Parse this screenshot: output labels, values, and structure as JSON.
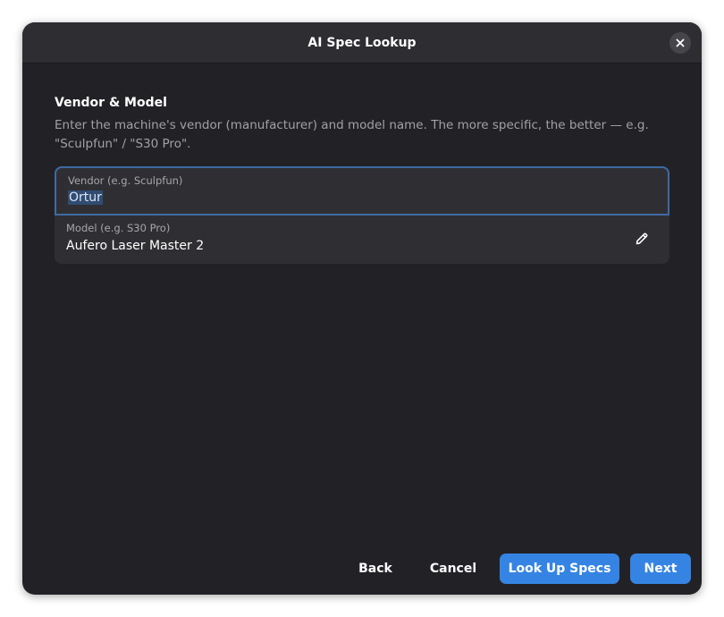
{
  "dialog": {
    "title": "AI Spec Lookup"
  },
  "section": {
    "title": "Vendor & Model",
    "description": "Enter the machine's vendor (manufacturer) and model name. The more specific, the better — e.g. \"Sculpfun\" / \"S30 Pro\"."
  },
  "vendor_field": {
    "label": "Vendor (e.g. Sculpfun)",
    "value": "Ortur"
  },
  "model_field": {
    "label": "Model (e.g. S30 Pro)",
    "value": "Aufero Laser Master 2"
  },
  "buttons": {
    "back": "Back",
    "cancel": "Cancel",
    "lookup": "Look Up Specs",
    "next": "Next"
  },
  "colors": {
    "accent": "#3584e4",
    "focus_border": "#3f6aa3",
    "dialog_bg": "#222226"
  },
  "icons": {
    "close": "close-icon",
    "edit": "pencil-icon"
  }
}
